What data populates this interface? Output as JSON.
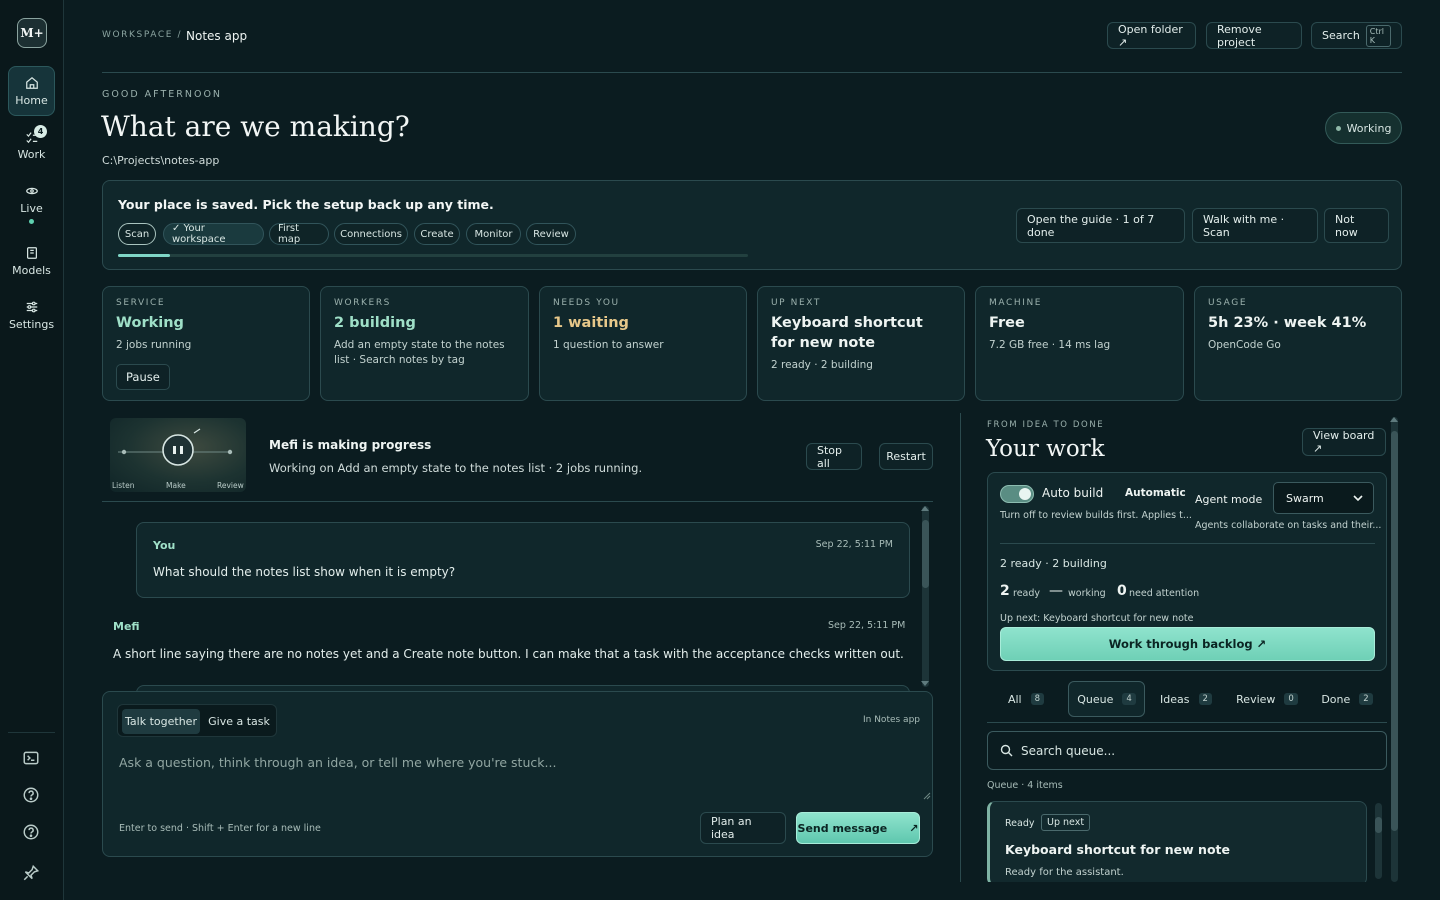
{
  "app": {
    "logo": "M+"
  },
  "nav": {
    "items": [
      {
        "label": "Home",
        "icon": "home-icon",
        "active": true
      },
      {
        "label": "Work",
        "icon": "check-list-icon",
        "badge": "4"
      },
      {
        "label": "Live",
        "icon": "link-icon"
      },
      {
        "label": "Models",
        "icon": "book-icon"
      },
      {
        "label": "Settings",
        "icon": "sliders-icon"
      }
    ],
    "bottom_icons": [
      "terminal-icon",
      "help-icon",
      "help-icon",
      "pin-icon"
    ]
  },
  "header": {
    "crumb_root": "WORKSPACE /",
    "crumb_page": "Notes app",
    "open_folder": "Open folder ↗",
    "remove_project": "Remove project",
    "search": "Search",
    "search_kbd": "Ctrl K"
  },
  "hero": {
    "greeting": "GOOD AFTERNOON",
    "title": "What are we making?",
    "path": "C:\\Projects\\notes-app",
    "status": "Working"
  },
  "setup": {
    "title": "Your place is saved. Pick the setup back up any time.",
    "steps": [
      "Scan",
      "✓ Your workspace",
      "First map",
      "Connections",
      "Create",
      "Monitor",
      "Review"
    ],
    "guide": "Open the guide · 1 of 7 done",
    "walk": "Walk with me · Scan",
    "dismiss": "Not now",
    "progress": 0.0833
  },
  "cards": [
    {
      "label": "SERVICE",
      "value": "Working",
      "sub": "2 jobs running",
      "button": "Pause"
    },
    {
      "label": "WORKERS",
      "value": "2 building",
      "sub": "Add an empty state to the notes list · Search notes by tag"
    },
    {
      "label": "NEEDS YOU",
      "value": "1 waiting",
      "sub": "1 question to answer"
    },
    {
      "label": "UP NEXT",
      "value": "Keyboard shortcut for new note",
      "sub": "2 ready · 2 building"
    },
    {
      "label": "MACHINE",
      "value": "Free",
      "sub": "7.2 GB free · 14 ms lag"
    },
    {
      "label": "USAGE",
      "value": "5h 23% · week 41%",
      "sub": "OpenCode Go"
    }
  ],
  "progress_banner": {
    "thumb_labels": [
      "Listen",
      "Make",
      "Review"
    ],
    "title": "Mefi is making progress",
    "sub": "Working on Add an empty state to the notes list · 2 jobs running.",
    "stop_all": "Stop all",
    "restart": "Restart"
  },
  "chat": {
    "messages": [
      {
        "who": "You",
        "when": "Sep 22, 5:11 PM",
        "text": "What should the notes list show when it is empty?"
      },
      {
        "who": "Mefi",
        "when": "Sep 22, 5:11 PM",
        "text": "A short line saying there are no notes yet and a Create note button. I can make that a task with the acceptance checks written out."
      }
    ]
  },
  "composer": {
    "mode_talk": "Talk together",
    "mode_task": "Give a task",
    "context": "In Notes app",
    "placeholder": "Ask a question, think through an idea, or tell me where you're stuck...",
    "hint": "Enter to send · Shift + Enter for a new line",
    "plan": "Plan an idea",
    "send": "Send message",
    "send_arrow": "↗"
  },
  "work": {
    "eyebrow": "FROM IDEA TO DONE",
    "title": "Your work",
    "view_board": "View board ↗",
    "auto_build_label": "Auto build",
    "auto_build_mode": "Automatic",
    "auto_build_desc": "Turn off to review builds first. Applies t...",
    "agent_mode_label": "Agent mode",
    "agent_mode_value": "Swarm",
    "agent_mode_desc": "Agents collaborate on tasks and their...",
    "summary": "2 ready · 2 building",
    "ready_num": "2",
    "ready_label": "ready",
    "working_num": "—",
    "working_label": "working",
    "attention_num": "0",
    "attention_label": "need attention",
    "up_next": "Up next: Keyboard shortcut for new note",
    "backlog": "Work through backlog ↗",
    "tabs": [
      {
        "label": "All",
        "count": "8"
      },
      {
        "label": "Queue",
        "count": "4",
        "active": true
      },
      {
        "label": "Ideas",
        "count": "2"
      },
      {
        "label": "Review",
        "count": "0"
      },
      {
        "label": "Done",
        "count": "2"
      }
    ],
    "search_placeholder": "Search queue...",
    "queue_count": "Queue · 4 items",
    "queue_items": [
      {
        "status": "Ready",
        "tag": "Up next",
        "title": "Keyboard shortcut for new note",
        "desc": "Ready for the assistant."
      }
    ]
  },
  "colors": {
    "accent": "#8fe3cd",
    "background": "#0b1c20",
    "card": "#10272b",
    "border": "#2b4a4e"
  }
}
